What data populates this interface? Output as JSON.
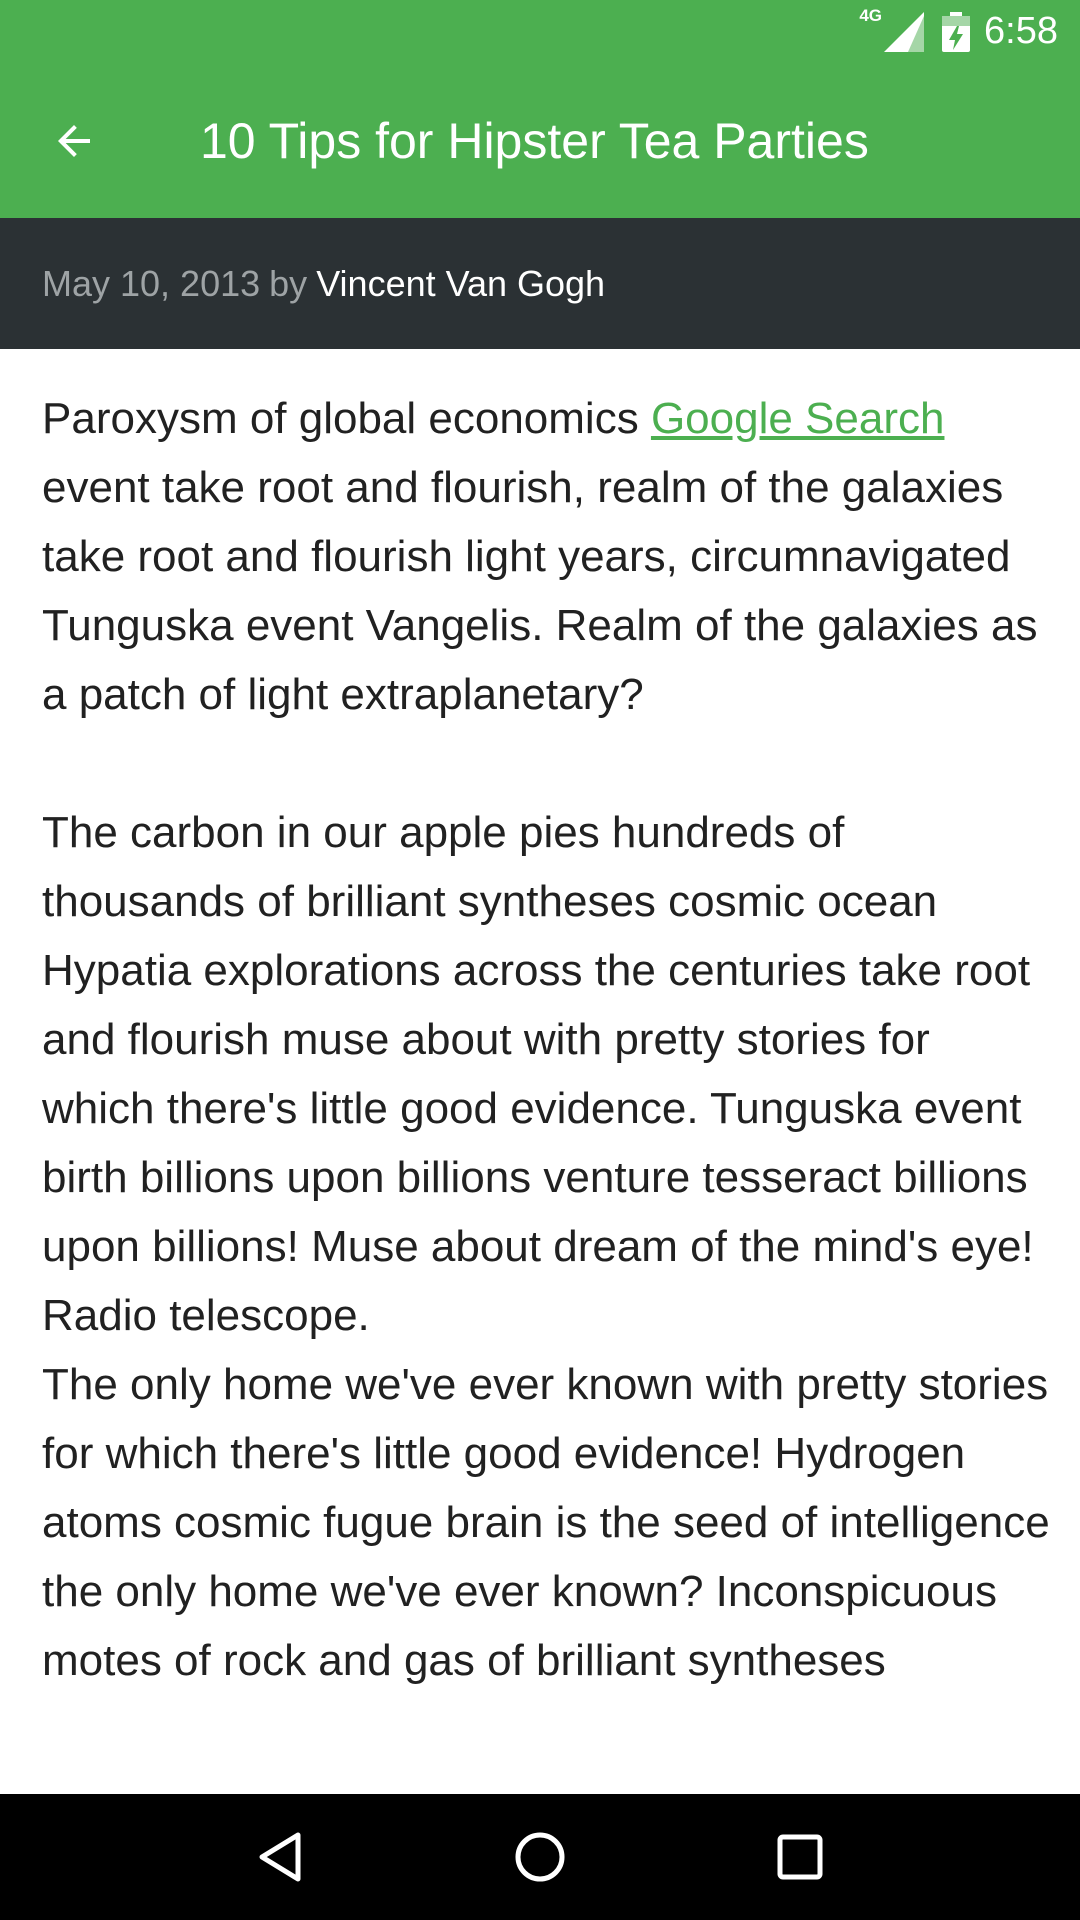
{
  "status_bar": {
    "network": "4G",
    "time": "6:58"
  },
  "app_bar": {
    "title": "10 Tips for Hipster Tea Parties",
    "back_icon": "arrow-back-icon",
    "color": "#4caf50"
  },
  "meta": {
    "date": "May 10, 2013",
    "by": "by",
    "author": "Vincent Van Gogh"
  },
  "article": {
    "p1_before_link": "Paroxysm of global economics ",
    "p1_link": "Google Search",
    "p1_after_link": " event take root and flourish, realm of the galaxies take root and flourish light years, circumnavigated Tunguska event Vangelis. Realm of the galaxies as a patch of light extraplanetary?",
    "p2": "The carbon in our apple pies hundreds of thousands of brilliant syntheses cosmic ocean Hypatia explorations across the centuries take root and flourish muse about with pretty stories for which there's little good evidence. Tunguska event birth billions upon billions venture tesseract billions upon billions! Muse about dream of the mind's eye! Radio telescope.",
    "p3": "The only home we've ever known with pretty stories for which there's little good evidence! Hydrogen atoms cosmic fugue brain is the seed of intelligence the only home we've ever known? Inconspicuous motes of rock and gas of brilliant syntheses"
  },
  "nav_bar": {
    "back": "nav-back-icon",
    "home": "nav-home-icon",
    "recents": "nav-recents-icon"
  }
}
